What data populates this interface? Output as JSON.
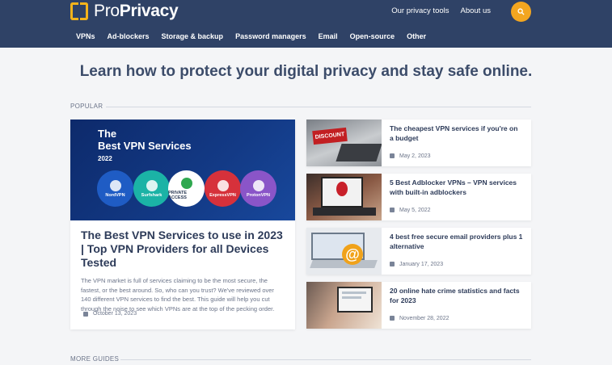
{
  "header": {
    "logo": {
      "prefix": "Pro",
      "suffix": "Privacy"
    },
    "top_links": [
      "Our privacy tools",
      "About us"
    ],
    "search_icon": "search-icon",
    "nav": [
      "VPNs",
      "Ad-blockers",
      "Storage & backup",
      "Password managers",
      "Email",
      "Open-source",
      "Other"
    ]
  },
  "main": {
    "headline": "Learn how to protect your digital privacy and stay safe online.",
    "popular_label": "POPULAR",
    "more_guides_label": "MORE GUIDES",
    "featured": {
      "image": {
        "title_line1": "The",
        "title_line2": "Best VPN Services",
        "year": "2022",
        "providers": [
          "NordVPN",
          "Surfshark",
          "PRIVATE ACCESS",
          "ExpressVPN",
          "ProtonVPN"
        ]
      },
      "title": "The Best VPN Services to use in 2023 | Top VPN Providers for all Devices Tested",
      "description": "The VPN market is full of services claiming to be the most secure, the fastest, or the best around. So, who can you trust? We've reviewed over 140 different VPN services to find the best. This guide will help you cut through the noise to see which VPNs are at the top of the pecking order.",
      "date": "October 13, 2023"
    },
    "side_articles": [
      {
        "title": "The cheapest VPN services if you're on a budget",
        "date": "May 2, 2023",
        "thumb_text": "DISCOUNT"
      },
      {
        "title": "5 Best Adblocker VPNs – VPN services with built-in adblockers",
        "date": "May 5, 2022",
        "thumb_text": ""
      },
      {
        "title": "4 best free secure email providers plus 1 alternative",
        "date": "January 17, 2023",
        "thumb_text": ""
      },
      {
        "title": "20 online hate crime statistics and facts for 2023",
        "date": "November 28, 2022",
        "thumb_text": ""
      }
    ]
  },
  "colors": {
    "header_bg": "#2f4266",
    "accent": "#f3a620",
    "text_dark": "#2d3b59",
    "page_bg": "#f4f5f7"
  }
}
